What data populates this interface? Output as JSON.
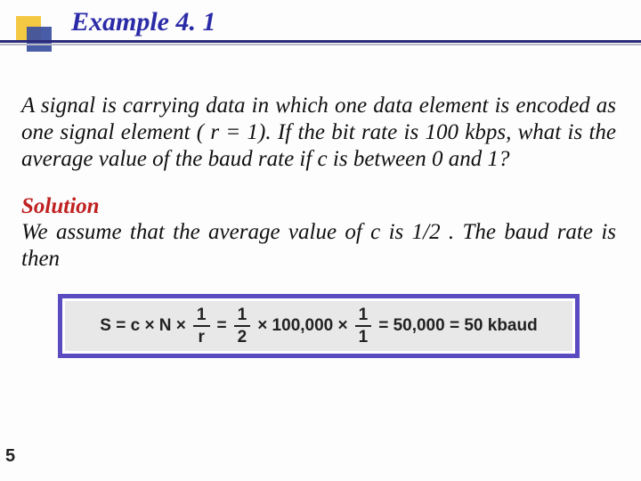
{
  "title": "Example 4. 1",
  "problem": "A signal is carrying data in which one data element is encoded as one signal element ( r = 1). If the bit rate is 100 kbps, what is the average value of the baud rate if c is between 0 and 1?",
  "solution_label": "Solution",
  "solution_text": "We assume that the average value of c is 1/2 . The baud rate is then",
  "formula": {
    "lhs": "S = c × N ×",
    "f1_num": "1",
    "f1_den": "r",
    "eq1": "=",
    "f2_num": "1",
    "f2_den": "2",
    "mid": "× 100,000 ×",
    "f3_num": "1",
    "f3_den": "1",
    "rhs": "= 50,000 = 50 kbaud"
  },
  "page_number": "5"
}
